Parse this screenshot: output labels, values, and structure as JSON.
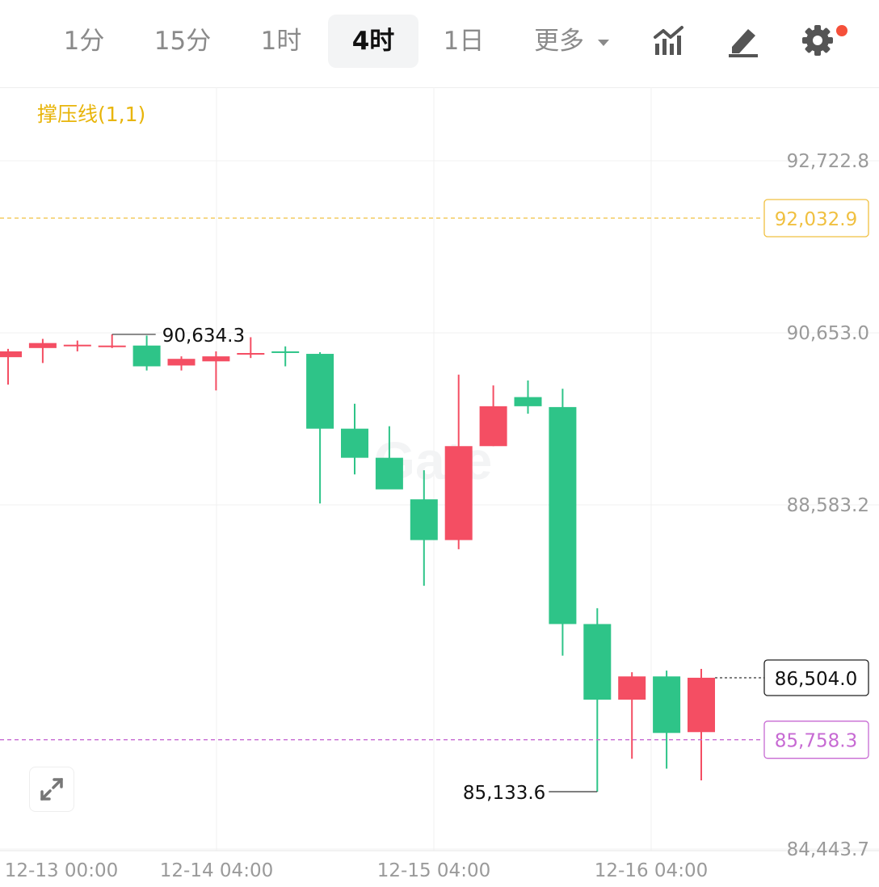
{
  "toolbar": {
    "tabs": [
      {
        "label": "1分",
        "active": false
      },
      {
        "label": "15分",
        "active": false
      },
      {
        "label": "1时",
        "active": false
      },
      {
        "label": "4时",
        "active": true
      },
      {
        "label": "1日",
        "active": false
      },
      {
        "label": "更多",
        "active": false,
        "dropdown": true
      }
    ],
    "icons": [
      "indicator-chart-icon",
      "draw-pen-icon",
      "settings-gear-icon"
    ],
    "settings_badge_color": "#f5503a"
  },
  "indicator_label": "撑压线(1,1)",
  "watermark": "Gate",
  "colors": {
    "up": "#f44e63",
    "down": "#2ec488",
    "resistance_line": "#f0c040",
    "support_line": "#c76ad3",
    "current_price_border": "#222222",
    "grid": "#f1f1f1",
    "axis_text": "#9a9a9a"
  },
  "chart_data": {
    "type": "candlestick",
    "title": "",
    "xlabel": "",
    "ylabel": "",
    "x_tick_labels": [
      "12-13 00:00",
      "12-14 04:00",
      "12-15 04:00",
      "12-16 04:00"
    ],
    "y_tick_labels": [
      "92,722.8",
      "90,653.0",
      "88,583.2",
      "84,443.7"
    ],
    "y_ticks": [
      92722.8,
      90653.0,
      88583.2,
      84443.7
    ],
    "ylim": [
      84443.7,
      93700
    ],
    "candles": [
      {
        "o": 90360,
        "h": 90460,
        "l": 90030,
        "c": 90430
      },
      {
        "o": 90470,
        "h": 90580,
        "l": 90290,
        "c": 90530
      },
      {
        "o": 90500,
        "h": 90560,
        "l": 90430,
        "c": 90510
      },
      {
        "o": 90490,
        "h": 90634.3,
        "l": 90470,
        "c": 90500
      },
      {
        "o": 90500,
        "h": 90620,
        "l": 90200,
        "c": 90250
      },
      {
        "o": 90260,
        "h": 90370,
        "l": 90200,
        "c": 90340
      },
      {
        "o": 90310,
        "h": 90430,
        "l": 89960,
        "c": 90370
      },
      {
        "o": 90400,
        "h": 90600,
        "l": 90350,
        "c": 90410
      },
      {
        "o": 90430,
        "h": 90490,
        "l": 90250,
        "c": 90420
      },
      {
        "o": 90400,
        "h": 90420,
        "l": 88600,
        "c": 89500
      },
      {
        "o": 89500,
        "h": 89800,
        "l": 88950,
        "c": 89150
      },
      {
        "o": 89150,
        "h": 89530,
        "l": 88890,
        "c": 88770
      },
      {
        "o": 88650,
        "h": 89000,
        "l": 87610,
        "c": 88160
      },
      {
        "o": 88160,
        "h": 90150,
        "l": 88050,
        "c": 89290
      },
      {
        "o": 89290,
        "h": 90020,
        "l": 89290,
        "c": 89770
      },
      {
        "o": 89880,
        "h": 90080,
        "l": 89680,
        "c": 89770
      },
      {
        "o": 89760,
        "h": 89980,
        "l": 86770,
        "c": 87150
      },
      {
        "o": 87150,
        "h": 87340,
        "l": 85133.6,
        "c": 86240
      },
      {
        "o": 86240,
        "h": 86570,
        "l": 85530,
        "c": 86520
      },
      {
        "o": 86520,
        "h": 86590,
        "l": 85410,
        "c": 85840
      },
      {
        "o": 85850,
        "h": 86610,
        "l": 85270,
        "c": 86504.0
      }
    ],
    "annotations": {
      "high_label": "90,634.3",
      "low_label": "85,133.6"
    },
    "price_lines": [
      {
        "label": "92,032.9",
        "value": 92032.9,
        "kind": "resistance"
      },
      {
        "label": "85,758.3",
        "value": 85758.3,
        "kind": "support"
      }
    ],
    "current_price": {
      "label": "86,504.0",
      "value": 86504.0
    },
    "grid": true
  }
}
